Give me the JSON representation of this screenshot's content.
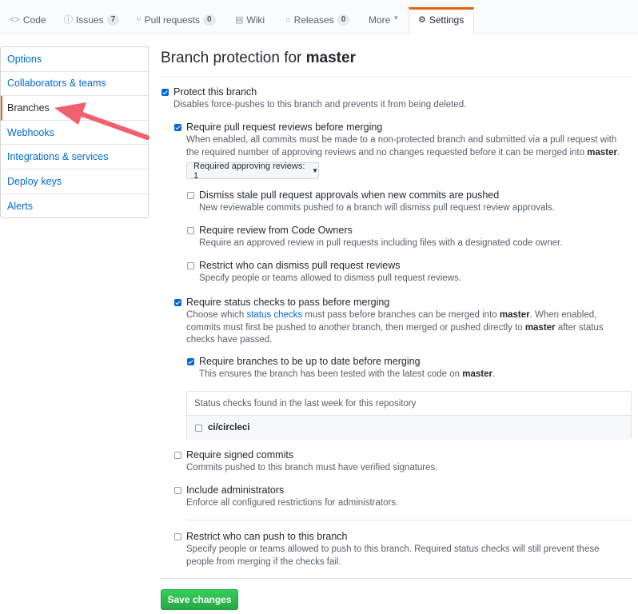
{
  "tabs": {
    "code": {
      "label": "Code",
      "icon": "code-icon"
    },
    "issues": {
      "label": "Issues",
      "count": "7",
      "icon": "issue-icon"
    },
    "pulls": {
      "label": "Pull requests",
      "count": "0",
      "icon": "pull-request-icon"
    },
    "wiki": {
      "label": "Wiki",
      "icon": "book-icon"
    },
    "releases": {
      "label": "Releases",
      "count": "0",
      "icon": "tag-icon"
    },
    "more": {
      "label": "More",
      "icon": "chevron-down-icon"
    },
    "settings": {
      "label": "Settings",
      "icon": "gear-icon",
      "selected": true
    }
  },
  "sidebar": {
    "items": [
      {
        "label": "Options"
      },
      {
        "label": "Collaborators & teams"
      },
      {
        "label": "Branches",
        "selected": true
      },
      {
        "label": "Webhooks"
      },
      {
        "label": "Integrations & services"
      },
      {
        "label": "Deploy keys"
      },
      {
        "label": "Alerts"
      }
    ]
  },
  "header": {
    "title_prefix": "Branch protection for ",
    "branch": "master"
  },
  "options": {
    "protect": {
      "label": "Protect this branch",
      "note": "Disables force-pushes to this branch and prevents it from being deleted.",
      "checked": true
    },
    "reviews": {
      "label": "Require pull request reviews before merging",
      "note_a": "When enabled, all commits must be made to a non-protected branch and submitted via a pull request with the required number of approving reviews and no changes requested before it can be merged into ",
      "note_branch": "master",
      "note_end": ".",
      "checked": true
    },
    "approving": {
      "label": "Required approving reviews: 1"
    },
    "dismiss_stale": {
      "label": "Dismiss stale pull request approvals when new commits are pushed",
      "note": "New reviewable commits pushed to a branch will dismiss pull request review approvals.",
      "checked": false
    },
    "code_owners": {
      "label": "Require review from Code Owners",
      "note": "Require an approved review in pull requests including files with a designated code owner.",
      "checked": false
    },
    "restrict_dismiss": {
      "label": "Restrict who can dismiss pull request reviews",
      "note": "Specify people or teams allowed to dismiss pull request reviews.",
      "checked": false
    },
    "status_checks": {
      "label": "Require status checks to pass before merging",
      "note_a": "Choose which ",
      "note_link": "status checks",
      "note_b": " must pass before branches can be merged into ",
      "note_branch": "master",
      "note_c": ". When enabled, commits must first be pushed to another branch, then merged or pushed directly to ",
      "note_branch2": "master",
      "note_d": " after status checks have passed.",
      "checked": true
    },
    "up_to_date": {
      "label": "Require branches to be up to date before merging",
      "note_a": "This ensures the branch has been tested with the latest code on ",
      "note_branch": "master",
      "note_end": ".",
      "checked": true
    },
    "status_box": {
      "header": "Status checks found in the last week for this repository",
      "items": [
        {
          "label": "ci/circleci",
          "checked": false
        }
      ]
    },
    "signed": {
      "label": "Require signed commits",
      "note": "Commits pushed to this branch must have verified signatures.",
      "checked": false
    },
    "admins": {
      "label": "Include administrators",
      "note": "Enforce all configured restrictions for administrators.",
      "checked": false
    },
    "restrict_push": {
      "label": "Restrict who can push to this branch",
      "note": "Specify people or teams allowed to push to this branch. Required status checks will still prevent these people from merging if the checks fail.",
      "checked": false
    }
  },
  "save_button": {
    "label": "Save changes"
  },
  "colors": {
    "accent_tab": "#e36209",
    "link": "#0366d6",
    "checkbox": "#0366d6",
    "save": "#28a745",
    "arrow": "#f0616f"
  }
}
